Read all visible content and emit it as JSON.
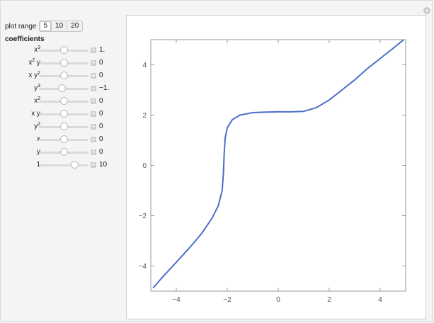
{
  "controls": {
    "plot_range_label": "plot range",
    "plot_range_options": [
      "5",
      "10",
      "20"
    ],
    "plot_range_selected": "5",
    "coefficients_label": "coefficients"
  },
  "sliders": [
    {
      "base": "x",
      "sup": "3",
      "tail": "",
      "value_text": "1.",
      "fraction": 0.5
    },
    {
      "base": "x",
      "sup": "2",
      "tail": " y",
      "value_text": "0",
      "fraction": 0.5
    },
    {
      "base": "x y",
      "sup": "2",
      "tail": "",
      "value_text": "0",
      "fraction": 0.5
    },
    {
      "base": "y",
      "sup": "3",
      "tail": "",
      "value_text": "−1.",
      "fraction": 0.45
    },
    {
      "base": "x",
      "sup": "2",
      "tail": "",
      "value_text": "0",
      "fraction": 0.5
    },
    {
      "base": "x y",
      "sup": "",
      "tail": "",
      "value_text": "0",
      "fraction": 0.5
    },
    {
      "base": "y",
      "sup": "2",
      "tail": "",
      "value_text": "0",
      "fraction": 0.5
    },
    {
      "base": "x",
      "sup": "",
      "tail": "",
      "value_text": "0",
      "fraction": 0.5
    },
    {
      "base": "y",
      "sup": "",
      "tail": "",
      "value_text": "0",
      "fraction": 0.5
    },
    {
      "base": "1",
      "sup": "",
      "tail": "",
      "value_text": "10",
      "fraction": 0.72
    }
  ],
  "chart_data": {
    "type": "line",
    "xlim": [
      -5,
      5
    ],
    "ylim": [
      -5,
      5
    ],
    "xticks": [
      -4,
      -2,
      0,
      2,
      4
    ],
    "yticks": [
      -4,
      -2,
      0,
      2,
      4
    ],
    "tick_labels_x": [
      "−4",
      "−2",
      "0",
      "2",
      "4"
    ],
    "tick_labels_y": [
      "−4",
      "−2",
      "0",
      "2",
      "4"
    ],
    "line_color": "#4a6fc9",
    "x": [
      -4.9,
      -4.5,
      -4.0,
      -3.5,
      -3.0,
      -2.6,
      -2.35,
      -2.2,
      -2.15,
      -2.12,
      -2.08,
      -2.0,
      -1.8,
      -1.5,
      -1.0,
      -0.5,
      0.0,
      0.5,
      1.0,
      1.5,
      2.0,
      2.5,
      3.0,
      3.5,
      4.0,
      4.5,
      4.9
    ],
    "y": [
      -4.86,
      -4.4,
      -3.85,
      -3.3,
      -2.7,
      -2.1,
      -1.6,
      -1.0,
      -0.3,
      0.5,
      1.1,
      1.5,
      1.82,
      2.0,
      2.1,
      2.12,
      2.13,
      2.13,
      2.15,
      2.3,
      2.6,
      3.0,
      3.4,
      3.85,
      4.25,
      4.65,
      4.98
    ]
  }
}
